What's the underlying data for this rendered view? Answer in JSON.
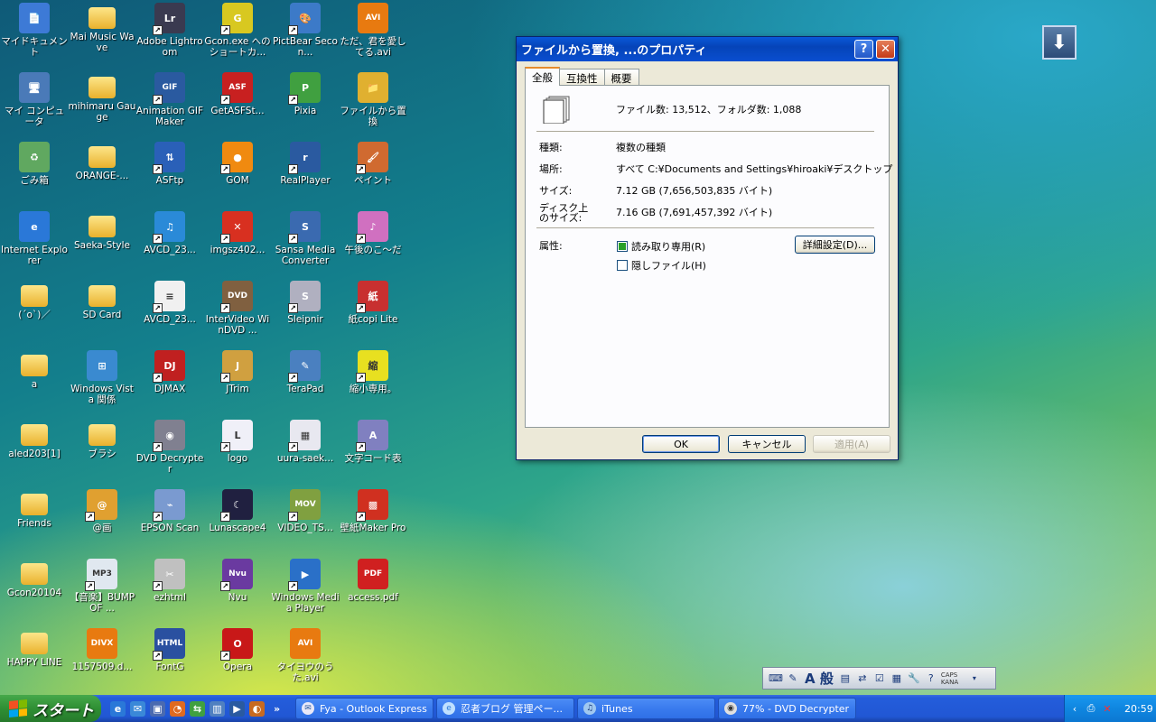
{
  "desktop_icons": [
    {
      "label": "マイドキュメント",
      "icon": "my-documents-icon",
      "color": "#3d7ad6",
      "glyph": "📄",
      "col": 0,
      "row": 0,
      "shortcut": false
    },
    {
      "label": "Mai Music Wave",
      "icon": "folder-icon",
      "col": 1,
      "row": 0,
      "shortcut": false,
      "folder": true
    },
    {
      "label": "Adobe Lightroom",
      "icon": "lightroom-icon",
      "color": "#3a3a50",
      "glyph": "Lr",
      "col": 2,
      "row": 0,
      "shortcut": true
    },
    {
      "label": "Gcon.exe へのショートカ...",
      "icon": "gcon-icon",
      "color": "#d8c820",
      "glyph": "G",
      "col": 3,
      "row": 0,
      "shortcut": true
    },
    {
      "label": "PictBear Secon...",
      "icon": "pictbear-icon",
      "color": "#3c7ac8",
      "glyph": "🎨",
      "col": 4,
      "row": 0,
      "shortcut": true
    },
    {
      "label": "ただ、君を愛してる.avi",
      "icon": "avi-file-icon",
      "color": "#e87a10",
      "glyph": "AVI",
      "col": 5,
      "row": 0,
      "shortcut": false
    },
    {
      "label": "マイ コンピュータ",
      "icon": "my-computer-icon",
      "color": "#4a7ab8",
      "glyph": "🖥",
      "col": 0,
      "row": 1,
      "shortcut": false
    },
    {
      "label": "mihimaru Gauge",
      "icon": "folder-icon",
      "col": 1,
      "row": 1,
      "shortcut": false,
      "folder": true
    },
    {
      "label": "Animation GIF Maker",
      "icon": "gif-maker-icon",
      "color": "#2a5aa0",
      "glyph": "GIF",
      "col": 2,
      "row": 1,
      "shortcut": true
    },
    {
      "label": "GetASFSt...",
      "icon": "asf-icon",
      "color": "#c82020",
      "glyph": "ASF",
      "col": 3,
      "row": 1,
      "shortcut": true
    },
    {
      "label": "Pixia",
      "icon": "pixia-icon",
      "color": "#40a040",
      "glyph": "P",
      "col": 4,
      "row": 1,
      "shortcut": true
    },
    {
      "label": "ファイルから置換",
      "icon": "replace-folder-icon",
      "color": "#e0b030",
      "glyph": "📁",
      "col": 5,
      "row": 1,
      "shortcut": false
    },
    {
      "label": "ごみ箱",
      "icon": "recycle-bin-icon",
      "color": "#60a860",
      "glyph": "♻",
      "col": 0,
      "row": 2,
      "shortcut": false
    },
    {
      "label": "ORANGE-...",
      "icon": "folder-icon",
      "col": 1,
      "row": 2,
      "shortcut": false,
      "folder": true
    },
    {
      "label": "ASFtp",
      "icon": "asftp-icon",
      "color": "#2a60b8",
      "glyph": "⇅",
      "col": 2,
      "row": 2,
      "shortcut": true
    },
    {
      "label": "GOM",
      "icon": "gom-icon",
      "color": "#f08a10",
      "glyph": "●",
      "col": 3,
      "row": 2,
      "shortcut": true
    },
    {
      "label": "RealPlayer",
      "icon": "realplayer-icon",
      "color": "#2a5aa0",
      "glyph": "r",
      "col": 4,
      "row": 2,
      "shortcut": true
    },
    {
      "label": "ペイント",
      "icon": "paint-icon",
      "color": "#d06a30",
      "glyph": "🖌",
      "col": 5,
      "row": 2,
      "shortcut": true
    },
    {
      "label": "Internet Explorer",
      "icon": "internet-explorer-icon",
      "color": "#2a78d8",
      "glyph": "e",
      "col": 0,
      "row": 3,
      "shortcut": false
    },
    {
      "label": "Saeka-Style",
      "icon": "folder-icon",
      "col": 1,
      "row": 3,
      "shortcut": false,
      "folder": true
    },
    {
      "label": "AVCD_23...",
      "icon": "avcd-icon",
      "color": "#2a8ad8",
      "glyph": "♫",
      "col": 2,
      "row": 3,
      "shortcut": true
    },
    {
      "label": "imgsz402...",
      "icon": "imgsz-icon",
      "color": "#d83020",
      "glyph": "✕",
      "col": 3,
      "row": 3,
      "shortcut": true
    },
    {
      "label": "Sansa Media Converter",
      "icon": "sansa-icon",
      "color": "#3a6ab0",
      "glyph": "S",
      "col": 4,
      "row": 3,
      "shortcut": true
    },
    {
      "label": "午後のこ〜だ",
      "icon": "gogo-icon",
      "color": "#d070c0",
      "glyph": "♪",
      "col": 5,
      "row": 3,
      "shortcut": true
    },
    {
      "label": "(´o`)／",
      "icon": "folder-icon",
      "col": 0,
      "row": 4,
      "shortcut": false,
      "folder": true
    },
    {
      "label": "SD Card",
      "icon": "folder-icon",
      "col": 1,
      "row": 4,
      "shortcut": false,
      "folder": true
    },
    {
      "label": "AVCD_23...",
      "icon": "text-file-icon",
      "color": "#f0f0f0",
      "glyph": "≡",
      "col": 2,
      "row": 4,
      "shortcut": true
    },
    {
      "label": "InterVideo WinDVD ...",
      "icon": "windvd-icon",
      "color": "#806040",
      "glyph": "DVD",
      "col": 3,
      "row": 4,
      "shortcut": true
    },
    {
      "label": "Sleipnir",
      "icon": "sleipnir-icon",
      "color": "#b0b0c0",
      "glyph": "S",
      "col": 4,
      "row": 4,
      "shortcut": true
    },
    {
      "label": "紙copi Lite",
      "icon": "kamicopi-icon",
      "color": "#c83030",
      "glyph": "紙",
      "col": 5,
      "row": 4,
      "shortcut": true
    },
    {
      "label": "a",
      "icon": "folder-icon",
      "col": 0,
      "row": 5,
      "shortcut": false,
      "folder": true
    },
    {
      "label": "Windows Vista 関係",
      "icon": "windows-flag-icon",
      "color": "#3a8ad0",
      "glyph": "⊞",
      "col": 1,
      "row": 5,
      "shortcut": false
    },
    {
      "label": "DJMAX",
      "icon": "djmax-icon",
      "color": "#c02020",
      "glyph": "DJ",
      "col": 2,
      "row": 5,
      "shortcut": true
    },
    {
      "label": "JTrim",
      "icon": "jtrim-icon",
      "color": "#d0a040",
      "glyph": "J",
      "col": 3,
      "row": 5,
      "shortcut": true
    },
    {
      "label": "TeraPad",
      "icon": "terapad-icon",
      "color": "#4a80c0",
      "glyph": "✎",
      "col": 4,
      "row": 5,
      "shortcut": true
    },
    {
      "label": "縮小専用。",
      "icon": "shukusho-icon",
      "color": "#e8e020",
      "glyph": "縮",
      "col": 5,
      "row": 5,
      "shortcut": true
    },
    {
      "label": "aled203[1]",
      "icon": "folder-icon",
      "col": 0,
      "row": 6,
      "shortcut": false,
      "folder": true
    },
    {
      "label": "ブラシ",
      "icon": "folder-icon",
      "col": 1,
      "row": 6,
      "shortcut": false,
      "folder": true
    },
    {
      "label": "DVD Decrypter",
      "icon": "dvd-decrypter-icon",
      "color": "#808090",
      "glyph": "◉",
      "col": 2,
      "row": 6,
      "shortcut": true
    },
    {
      "label": "logo",
      "icon": "logo-icon",
      "color": "#f0f0f8",
      "glyph": "L",
      "col": 3,
      "row": 6,
      "shortcut": true
    },
    {
      "label": "uura-saek...",
      "icon": "image-file-icon",
      "color": "#e8e8f0",
      "glyph": "▦",
      "col": 4,
      "row": 6,
      "shortcut": true
    },
    {
      "label": "文字コード表",
      "icon": "charmap-icon",
      "color": "#8080c0",
      "glyph": "A",
      "col": 5,
      "row": 6,
      "shortcut": true
    },
    {
      "label": "Friends",
      "icon": "folder-icon",
      "col": 0,
      "row": 7,
      "shortcut": false,
      "folder": true
    },
    {
      "label": "@画",
      "icon": "atga-icon",
      "color": "#e0a030",
      "glyph": "@",
      "col": 1,
      "row": 7,
      "shortcut": true
    },
    {
      "label": "EPSON Scan",
      "icon": "epson-scan-icon",
      "color": "#7a9ad0",
      "glyph": "⌁",
      "col": 2,
      "row": 7,
      "shortcut": true
    },
    {
      "label": "Lunascape4",
      "icon": "lunascape-icon",
      "color": "#202040",
      "glyph": "☾",
      "col": 3,
      "row": 7,
      "shortcut": true
    },
    {
      "label": "VIDEO_TS...",
      "icon": "mov-file-icon",
      "color": "#80a040",
      "glyph": "MOV",
      "col": 4,
      "row": 7,
      "shortcut": true
    },
    {
      "label": "壁紙Maker Pro",
      "icon": "kabegami-icon",
      "color": "#d03020",
      "glyph": "▩",
      "col": 5,
      "row": 7,
      "shortcut": true
    },
    {
      "label": "Gcon20104",
      "icon": "folder-icon",
      "col": 0,
      "row": 8,
      "shortcut": false,
      "folder": true
    },
    {
      "label": "【音楽】BUMP OF ...",
      "icon": "mp3-file-icon",
      "color": "#e0e8f0",
      "glyph": "MP3",
      "col": 1,
      "row": 8,
      "shortcut": true
    },
    {
      "label": "ezhtml",
      "icon": "ezhtml-icon",
      "color": "#c0c0c0",
      "glyph": "✂",
      "col": 2,
      "row": 8,
      "shortcut": true
    },
    {
      "label": "Nvu",
      "icon": "nvu-icon",
      "color": "#6a3aa0",
      "glyph": "Nvu",
      "col": 3,
      "row": 8,
      "shortcut": true
    },
    {
      "label": "Windows Media Player",
      "icon": "media-player-icon",
      "color": "#2a70c8",
      "glyph": "▶",
      "col": 4,
      "row": 8,
      "shortcut": true
    },
    {
      "label": "access.pdf",
      "icon": "pdf-file-icon",
      "color": "#d02020",
      "glyph": "PDF",
      "col": 5,
      "row": 8,
      "shortcut": false
    },
    {
      "label": "HAPPY LINE",
      "icon": "folder-icon",
      "col": 0,
      "row": 9,
      "shortcut": false,
      "folder": true
    },
    {
      "label": "1157509.d...",
      "icon": "divx-file-icon",
      "color": "#e87a10",
      "glyph": "DIVX",
      "col": 1,
      "row": 9,
      "shortcut": false
    },
    {
      "label": "FontG",
      "icon": "fontg-icon",
      "color": "#2a50a0",
      "glyph": "HTML",
      "col": 2,
      "row": 9,
      "shortcut": true
    },
    {
      "label": "Opera",
      "icon": "opera-icon",
      "color": "#c81818",
      "glyph": "O",
      "col": 3,
      "row": 9,
      "shortcut": true
    },
    {
      "label": "タイヨウのうた.avi",
      "icon": "avi-file-icon",
      "color": "#e87a10",
      "glyph": "AVI",
      "col": 4,
      "row": 9,
      "shortcut": false
    }
  ],
  "dialog": {
    "title": "ファイルから置換, ...のプロパティ",
    "help_label": "?",
    "close_label": "✕",
    "tabs": [
      "全般",
      "互換性",
      "概要"
    ],
    "summary": "ファイル数: 13,512、フォルダ数: 1,088",
    "type_label": "種類:",
    "type_value": "複数の種類",
    "location_label": "場所:",
    "location_value": "すべて C:¥Documents and Settings¥hiroaki¥デスクトップ",
    "size_label": "サイズ:",
    "size_value": "7.12 GB (7,656,503,835 バイト)",
    "disk_size_label": "ディスク上のサイズ:",
    "disk_size_value": "7.16 GB (7,691,457,392 バイト)",
    "attributes_label": "属性:",
    "readonly_label": "読み取り専用(R)",
    "hidden_label": "隠しファイル(H)",
    "advanced_label": "詳細設定(D)...",
    "ok_label": "OK",
    "cancel_label": "キャンセル",
    "apply_label": "適用(A)"
  },
  "langbar": {
    "mode": "A 般",
    "caps": "CAPS",
    "kana": "KANA"
  },
  "taskbar": {
    "start_label": "スタート",
    "overflow": "»",
    "tasks": [
      {
        "label": "Fya - Outlook Express",
        "icon": "outlook-express-icon",
        "color": "#e8e8f8"
      },
      {
        "label": "忍者ブログ 管理ペー...",
        "icon": "internet-explorer-icon",
        "color": "#bfe0ff"
      },
      {
        "label": "iTunes",
        "icon": "itunes-icon",
        "color": "#a0c8f0"
      },
      {
        "label": "77% - DVD Decrypter",
        "icon": "dvd-decrypter-icon",
        "color": "#e0e0e0"
      }
    ],
    "clock": "20:59"
  }
}
